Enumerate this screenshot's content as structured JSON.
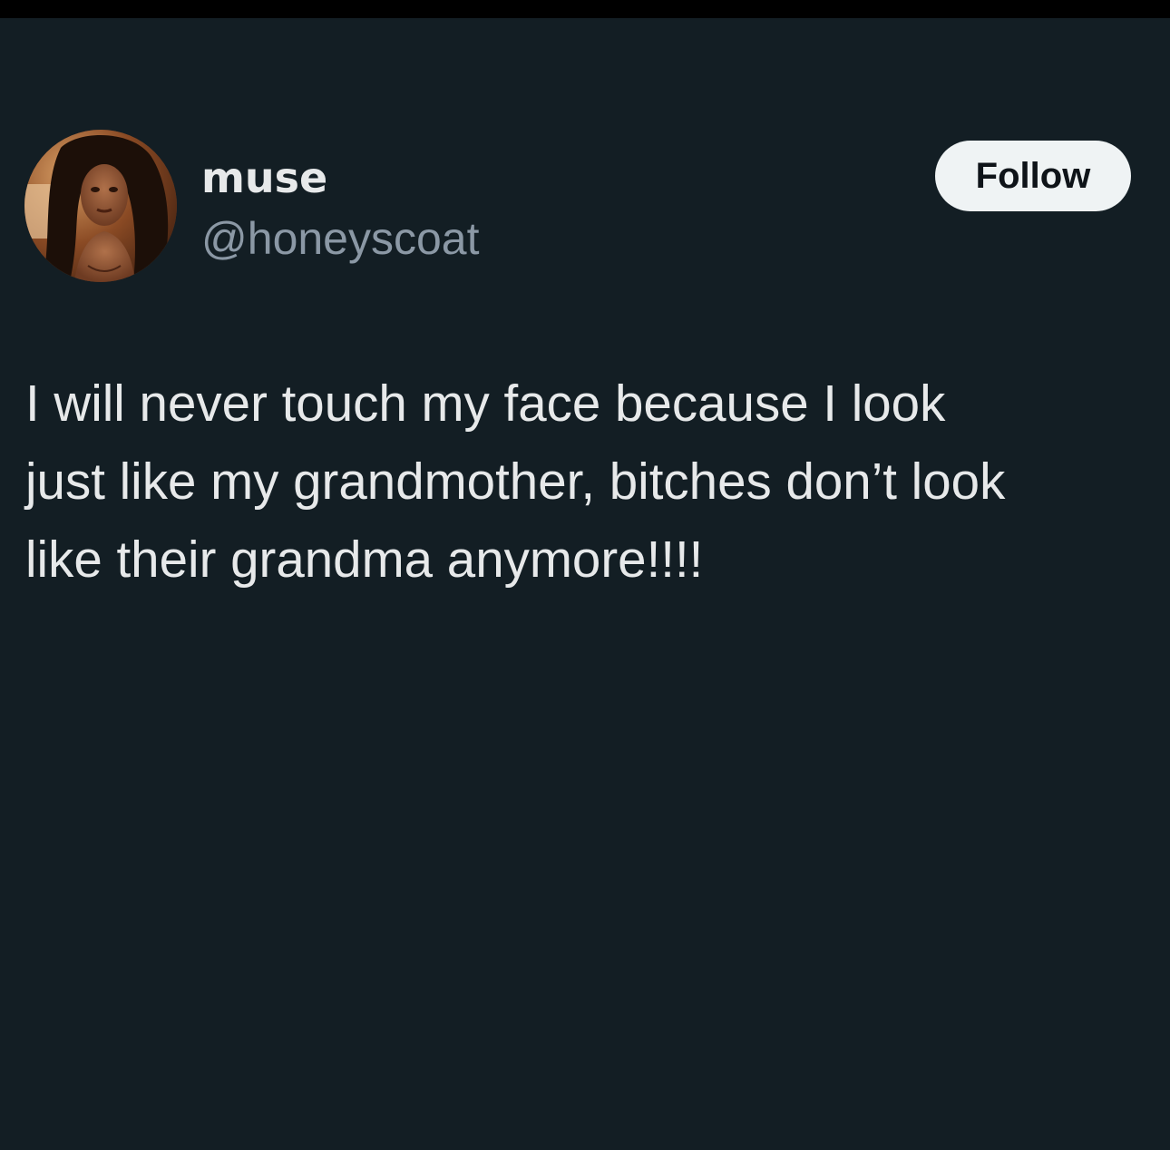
{
  "tweet": {
    "author": {
      "display_name": "muse",
      "handle": "@honeyscoat",
      "avatar": "profile-photo"
    },
    "follow_label": "Follow",
    "text_lines": [
      "I will never touch my face because I look",
      "just like my grandmother, bitches don’t look",
      "like their grandma anymore!!!!"
    ]
  },
  "colors": {
    "background": "#131e24",
    "primary_text": "#e7e9ea",
    "secondary_text": "#8b98a5",
    "button_bg": "#eff3f4",
    "button_text": "#0f1419"
  }
}
